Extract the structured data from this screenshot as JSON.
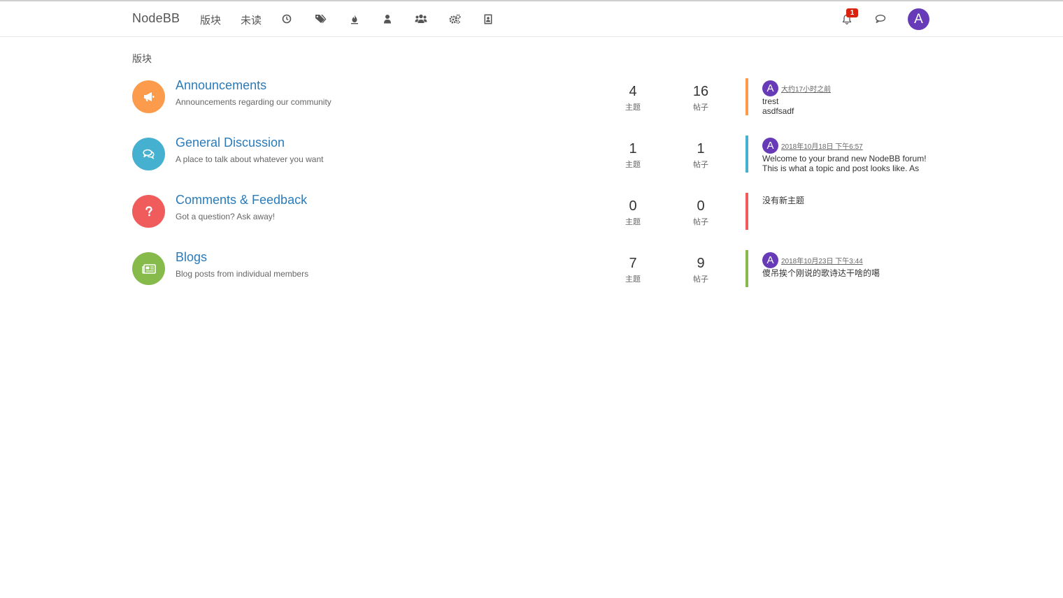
{
  "nav": {
    "brand": "NodeBB",
    "links": [
      {
        "label": "版块"
      },
      {
        "label": "未读"
      }
    ],
    "icons": [
      "recent-clock-icon",
      "tags-icon",
      "popular-fire-icon",
      "users-icon",
      "groups-icon",
      "admin-cogs-icon",
      "moderation-icon"
    ],
    "notification_count": "1",
    "user_initial": "A",
    "accent": "#673ab7"
  },
  "breadcrumb": "版块",
  "categories": [
    {
      "title": "Announcements",
      "description": "Announcements regarding our community",
      "icon": "bullhorn-icon",
      "color": "#fd9b4d",
      "topics": "4",
      "topics_label": "主题",
      "posts": "16",
      "posts_label": "帖子",
      "teaser": {
        "avatar": "A",
        "time": "大约17小时之前",
        "line1": "trest",
        "line2": "asdfsadf",
        "empty": ""
      }
    },
    {
      "title": "General Discussion",
      "description": "A place to talk about whatever you want",
      "icon": "comments-icon",
      "color": "#45b0cf",
      "topics": "1",
      "topics_label": "主题",
      "posts": "1",
      "posts_label": "帖子",
      "teaser": {
        "avatar": "A",
        "time": "2018年10月18日 下午6:57",
        "line1": "Welcome to your brand new NodeBB forum!",
        "line2": "This is what a topic and post looks like. As",
        "empty": ""
      }
    },
    {
      "title": "Comments & Feedback",
      "description": "Got a question? Ask away!",
      "icon": "question-icon",
      "color": "#f05b5b",
      "topics": "0",
      "topics_label": "主题",
      "posts": "0",
      "posts_label": "帖子",
      "teaser": {
        "avatar": "",
        "time": "",
        "line1": "",
        "line2": "",
        "empty": "没有新主题"
      }
    },
    {
      "title": "Blogs",
      "description": "Blog posts from individual members",
      "icon": "newspaper-icon",
      "color": "#86ba4b",
      "topics": "7",
      "topics_label": "主题",
      "posts": "9",
      "posts_label": "帖子",
      "teaser": {
        "avatar": "A",
        "time": "2018年10月23日 下午3:44",
        "line1": "傻吊挨个刚说的歌诗达干啥的噶",
        "line2": "",
        "empty": ""
      }
    }
  ]
}
